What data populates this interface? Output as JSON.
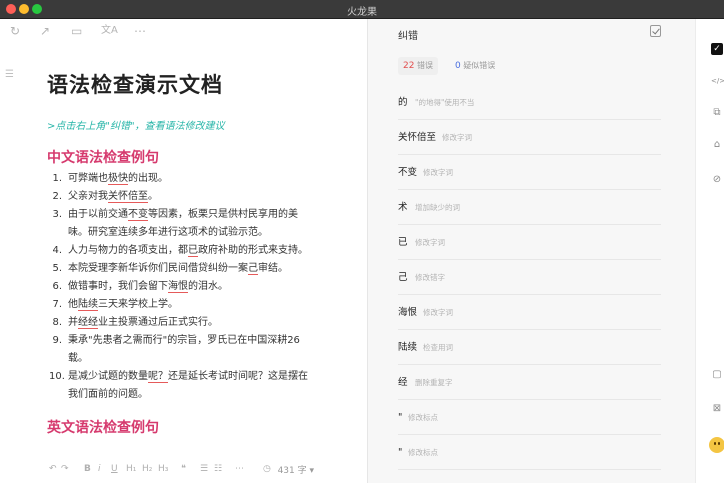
{
  "window": {
    "title": "火龙果"
  },
  "editor": {
    "top_icons": [
      "↻",
      "↗",
      "▭",
      "文A",
      "⋯"
    ],
    "title": "语法检查演示文档",
    "hint": ">点击右上角\"纠错\"，查看语法修改建议",
    "section_cn": "中文语法检查例句",
    "section_en": "英文语法检查例句",
    "items": [
      {
        "num": "1.",
        "pre": "可弊端也",
        "err": "极快",
        "post": "的出现。",
        "line2": ""
      },
      {
        "num": "2.",
        "pre": "父亲对我",
        "err": "关怀倍至",
        "post": "。",
        "line2": ""
      },
      {
        "num": "3.",
        "pre": "由于以前交通",
        "err": "不变",
        "post": "等因素，板栗只是供村民享用的美",
        "line2": "味。研究室连续多年进行这项术的试验示范。"
      },
      {
        "num": "4.",
        "pre": "人力与物力的各项支出，都",
        "err": "已",
        "post": "政府补助的形式来支持。",
        "line2": ""
      },
      {
        "num": "5.",
        "pre": "本院受理李新华诉你们民间借贷纠纷一案",
        "err": "己",
        "post": "审结。",
        "line2": ""
      },
      {
        "num": "6.",
        "pre": "做错事时，我们会留下",
        "err": "海恨",
        "post": "的泪水。",
        "line2": ""
      },
      {
        "num": "7.",
        "pre": "他",
        "err": "陆续",
        "post": "三天来学校上学。",
        "line2": ""
      },
      {
        "num": "8.",
        "pre": "并",
        "err": "经经",
        "post": "业主投票通过后正式实行。",
        "line2": ""
      },
      {
        "num": "9.",
        "pre": "秉承\"先患者之需而行\"的宗旨，罗氏已在中国深耕26",
        "err": "",
        "post": "",
        "line2": "载。"
      },
      {
        "num": "10.",
        "pre": "是减少试题的数量",
        "err": "呢？",
        "post": "还是延长考试时间呢？这是摆在",
        "line2": "我们面前的问题。"
      }
    ],
    "bottom_tools": [
      "↶",
      "↷",
      "B",
      "i",
      "U",
      "H₁",
      "H₂",
      "H₃",
      "❝",
      "☰",
      "☷",
      "⋯",
      "◷"
    ],
    "word_count": "431 字 ▾"
  },
  "panel": {
    "title": "纠错",
    "error_count": "22",
    "error_label": "错误",
    "suspect_count": "0",
    "suspect_label": "疑似错误",
    "rows": [
      {
        "term": "的",
        "desc": "\"的地得\"使用不当"
      },
      {
        "term": "关怀倍至",
        "desc": "修改字词"
      },
      {
        "term": "不变",
        "desc": "修改字词"
      },
      {
        "term": "术",
        "desc": "增加缺少的词"
      },
      {
        "term": "已",
        "desc": "修改字词"
      },
      {
        "term": "己",
        "desc": "修改错字"
      },
      {
        "term": "海恨",
        "desc": "修改字词"
      },
      {
        "term": "陆续",
        "desc": "检查用词"
      },
      {
        "term": "经",
        "desc": "删除重复字"
      },
      {
        "term": "\"",
        "desc": "修改标点"
      },
      {
        "term": "\"",
        "desc": "修改标点"
      }
    ]
  },
  "strip": {
    "icons": [
      "✓",
      "</>",
      "⧉",
      "⌂",
      "⊘",
      "▢",
      "⊠"
    ]
  }
}
